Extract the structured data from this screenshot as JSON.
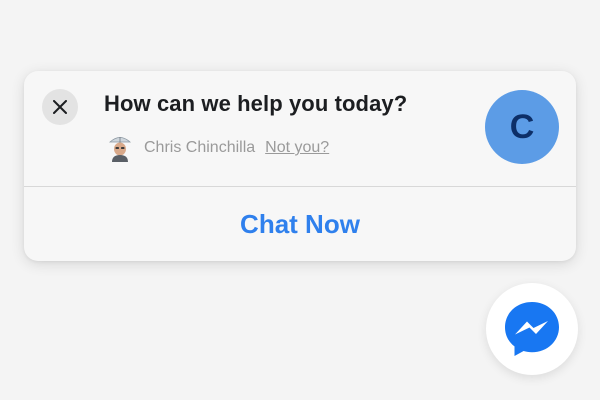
{
  "prompt": {
    "title": "How can we help you today?",
    "user_name": "Chris Chinchilla",
    "not_you_link": "Not you?",
    "avatar_initial": "C",
    "cta_label": "Chat Now"
  },
  "icons": {
    "close": "close-icon",
    "user_photo": "user-photo",
    "messenger": "messenger-icon"
  },
  "colors": {
    "accent": "#2f80ed",
    "avatar_bg": "#5c9ce6",
    "avatar_text": "#0d2f68",
    "messenger_blue": "#1877f2",
    "background": "#f4f4f4"
  }
}
